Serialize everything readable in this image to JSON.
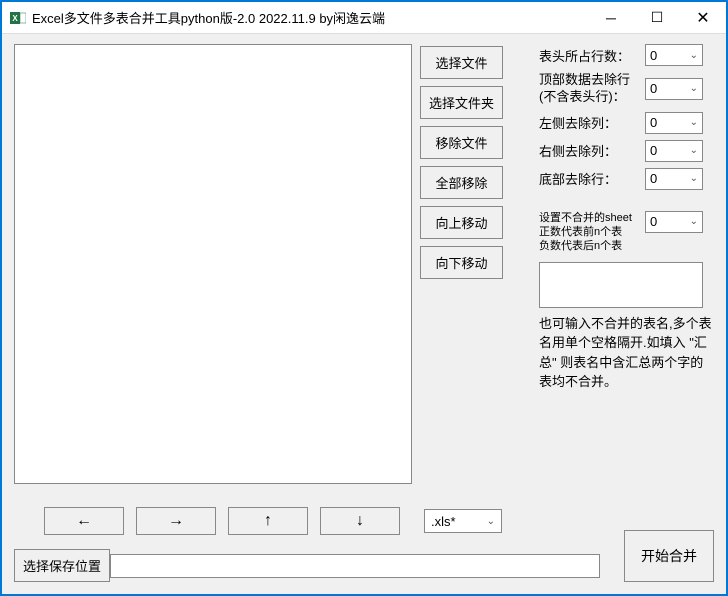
{
  "window": {
    "title": "Excel多文件多表合并工具python版-2.0 2022.11.9 by闲逸云端"
  },
  "buttons": {
    "select_files": "选择文件",
    "select_folder": "选择文件夹",
    "remove_file": "移除文件",
    "remove_all": "全部移除",
    "move_up": "向上移动",
    "move_down": "向下移动",
    "save_location": "选择保存位置",
    "start_merge": "开始合并",
    "nav_left": "←",
    "nav_right": "→",
    "nav_up": "↑",
    "nav_down": "↓"
  },
  "params": {
    "header_rows": {
      "label": "表头所占行数：",
      "value": "0"
    },
    "top_remove": {
      "label": "顶部数据去除行(不含表头行)：",
      "value": "0"
    },
    "left_remove": {
      "label": "左侧去除列：",
      "value": "0"
    },
    "right_remove": {
      "label": "右侧去除列：",
      "value": "0"
    },
    "bottom_remove": {
      "label": "底部去除行：",
      "value": "0"
    },
    "sheet_exclude": {
      "label": "设置不合并的sheet\n正数代表前n个表\n负数代表后n个表",
      "value": "0"
    }
  },
  "help_text": "也可输入不合并的表名,多个表名用单个空格隔开.如填入 \"汇总\" 则表名中含汇总两个字的表均不合并。",
  "ext_filter": ".xls*",
  "save_path": ""
}
